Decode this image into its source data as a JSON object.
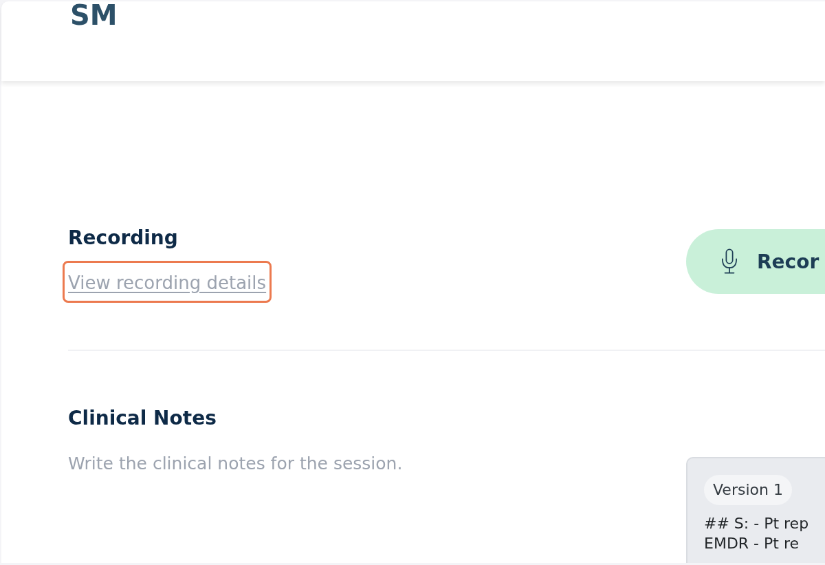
{
  "header": {
    "initials": "SM"
  },
  "recording": {
    "title": "Recording",
    "link": {
      "text": "View recording details",
      "highlighted": true
    },
    "record_button": {
      "label": "Recor"
    }
  },
  "clinical_notes": {
    "title": "Clinical Notes",
    "description": "Write the clinical notes for the session.",
    "version_panel": {
      "version_label": "Version 1",
      "lines": [
        "## S: - Pt rep",
        "EMDR - Pt re"
      ]
    }
  }
}
